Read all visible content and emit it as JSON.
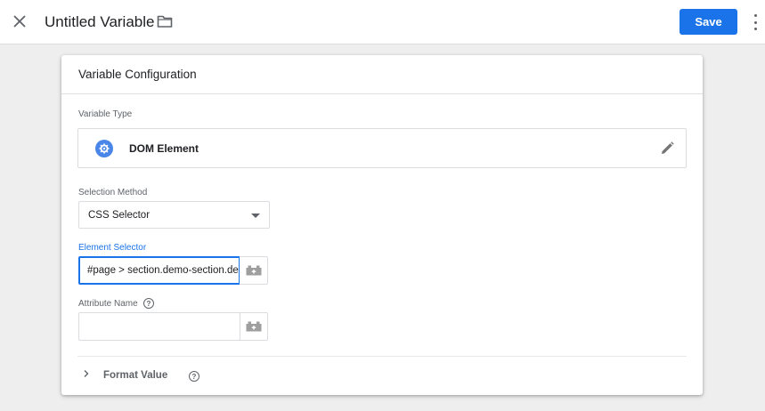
{
  "header": {
    "title": "Untitled Variable",
    "save_label": "Save"
  },
  "card": {
    "title": "Variable Configuration",
    "variable_type_label": "Variable Type",
    "variable_type_name": "DOM Element",
    "selection_method_label": "Selection Method",
    "selection_method_value": "CSS Selector",
    "element_selector_label": "Element Selector",
    "element_selector_value": "#page > section.demo-section.de",
    "attribute_name_label": "Attribute Name",
    "attribute_name_value": "",
    "format_value_label": "Format Value",
    "help_glyph": "?"
  },
  "colors": {
    "accent": "#1a73e8",
    "type_icon": "#4a86e8",
    "background": "#eeeeee"
  },
  "icons": [
    "close-icon",
    "folder-icon",
    "more-vert-icon",
    "gear-icon",
    "pencil-icon",
    "variable-brick-icon",
    "help-icon",
    "chevron-right-icon",
    "dropdown-arrow-icon"
  ]
}
